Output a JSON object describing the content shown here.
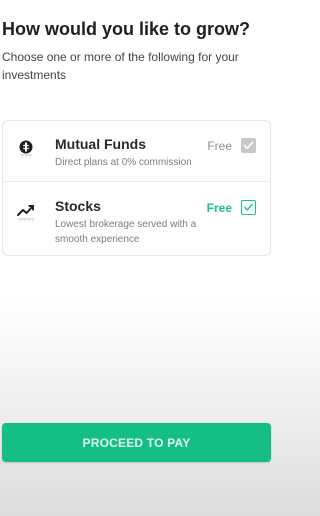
{
  "header": {
    "title": "How would you like to grow?",
    "subtitle": "Choose one or more of the following for your investments"
  },
  "options": [
    {
      "title": "Mutual Funds",
      "description": "Direct plans at 0% commission",
      "price": "Free",
      "selected": false,
      "icon": "mutual-funds-icon"
    },
    {
      "title": "Stocks",
      "description": "Lowest brokerage served with a smooth experience",
      "price": "Free",
      "selected": true,
      "icon": "stocks-chart-icon"
    }
  ],
  "footer": {
    "proceed_label": "PROCEED TO PAY"
  },
  "colors": {
    "accent": "#15be83",
    "accent_text": "#19c48b",
    "muted_checkbox": "#c8c8c8"
  }
}
